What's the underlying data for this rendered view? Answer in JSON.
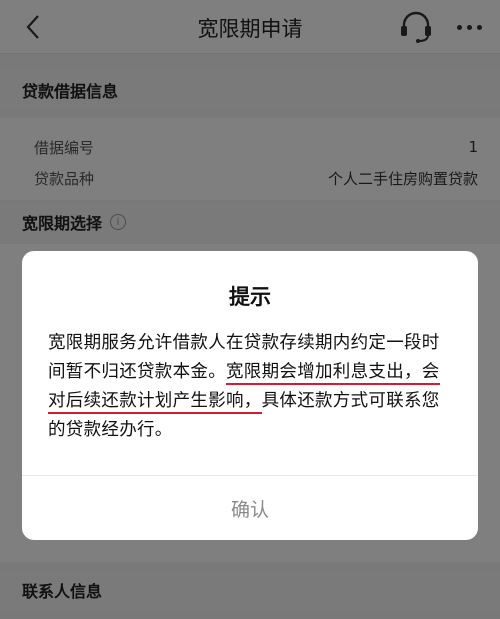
{
  "nav": {
    "title": "宽限期申请",
    "back_icon": "chevron-left-icon",
    "support_icon": "headset-icon",
    "more_icon": "more-dots-icon"
  },
  "loan_info": {
    "header": "贷款借据信息",
    "rows": [
      {
        "label": "借据编号",
        "value": "1"
      },
      {
        "label": "贷款品种",
        "value": "个人二手住房购置贷款"
      }
    ]
  },
  "grace_period": {
    "header": "宽限期选择",
    "info_icon": "info-circle-icon"
  },
  "contact": {
    "header": "联系人信息"
  },
  "dialog": {
    "title": "提示",
    "body_part1": "宽限期服务允许借款人在贷款存续期内约定一段时间暂不归还贷款本金。",
    "body_highlight": "宽限期会增加利息支出，会对后续还款计划产生影响，",
    "body_part2": "具体还款方式可联系您的贷款经办行。",
    "confirm_label": "确认",
    "highlight_color": "#d21c34"
  }
}
